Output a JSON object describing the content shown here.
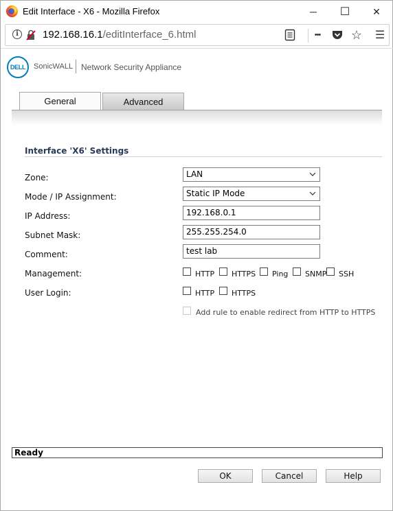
{
  "window": {
    "title": "Edit Interface - X6 - Mozilla Firefox"
  },
  "urlbar": {
    "host": "192.168.16.1",
    "path": "/editInterface_6.html"
  },
  "header": {
    "logo_text": "DELL",
    "product": "SonicWALL",
    "subtitle": "Network Security Appliance"
  },
  "tabs": [
    {
      "label": "General",
      "active": true
    },
    {
      "label": "Advanced",
      "active": false
    }
  ],
  "section": {
    "title": "Interface 'X6' Settings"
  },
  "form": {
    "zone": {
      "label": "Zone:",
      "value": "LAN"
    },
    "mode": {
      "label": "Mode / IP Assignment:",
      "value": "Static IP Mode"
    },
    "ip": {
      "label": "IP Address:",
      "value": "192.168.0.1"
    },
    "subnet": {
      "label": "Subnet Mask:",
      "value": "255.255.254.0"
    },
    "comment": {
      "label": "Comment:",
      "value": "test lab"
    },
    "management": {
      "label": "Management:",
      "options": [
        {
          "label": "HTTP",
          "checked": false
        },
        {
          "label": "HTTPS",
          "checked": false
        },
        {
          "label": "Ping",
          "checked": false
        },
        {
          "label": "SNMP",
          "checked": false
        },
        {
          "label": "SSH",
          "checked": false
        }
      ]
    },
    "user_login": {
      "label": "User Login:",
      "options": [
        {
          "label": "HTTP",
          "checked": false
        },
        {
          "label": "HTTPS",
          "checked": false
        }
      ]
    },
    "redirect": {
      "label": "Add rule to enable redirect from HTTP to HTTPS",
      "checked": false,
      "disabled": true
    }
  },
  "status": "Ready",
  "buttons": {
    "ok": "OK",
    "cancel": "Cancel",
    "help": "Help"
  },
  "icons": {
    "window_minimize": "─",
    "window_maximize": "☐",
    "window_close": "✕",
    "info": "i",
    "more": "•••",
    "bookmark": "☆",
    "menu": "☰"
  },
  "colors": {
    "dell_blue": "#007db8",
    "section_title": "#2a3b58"
  }
}
